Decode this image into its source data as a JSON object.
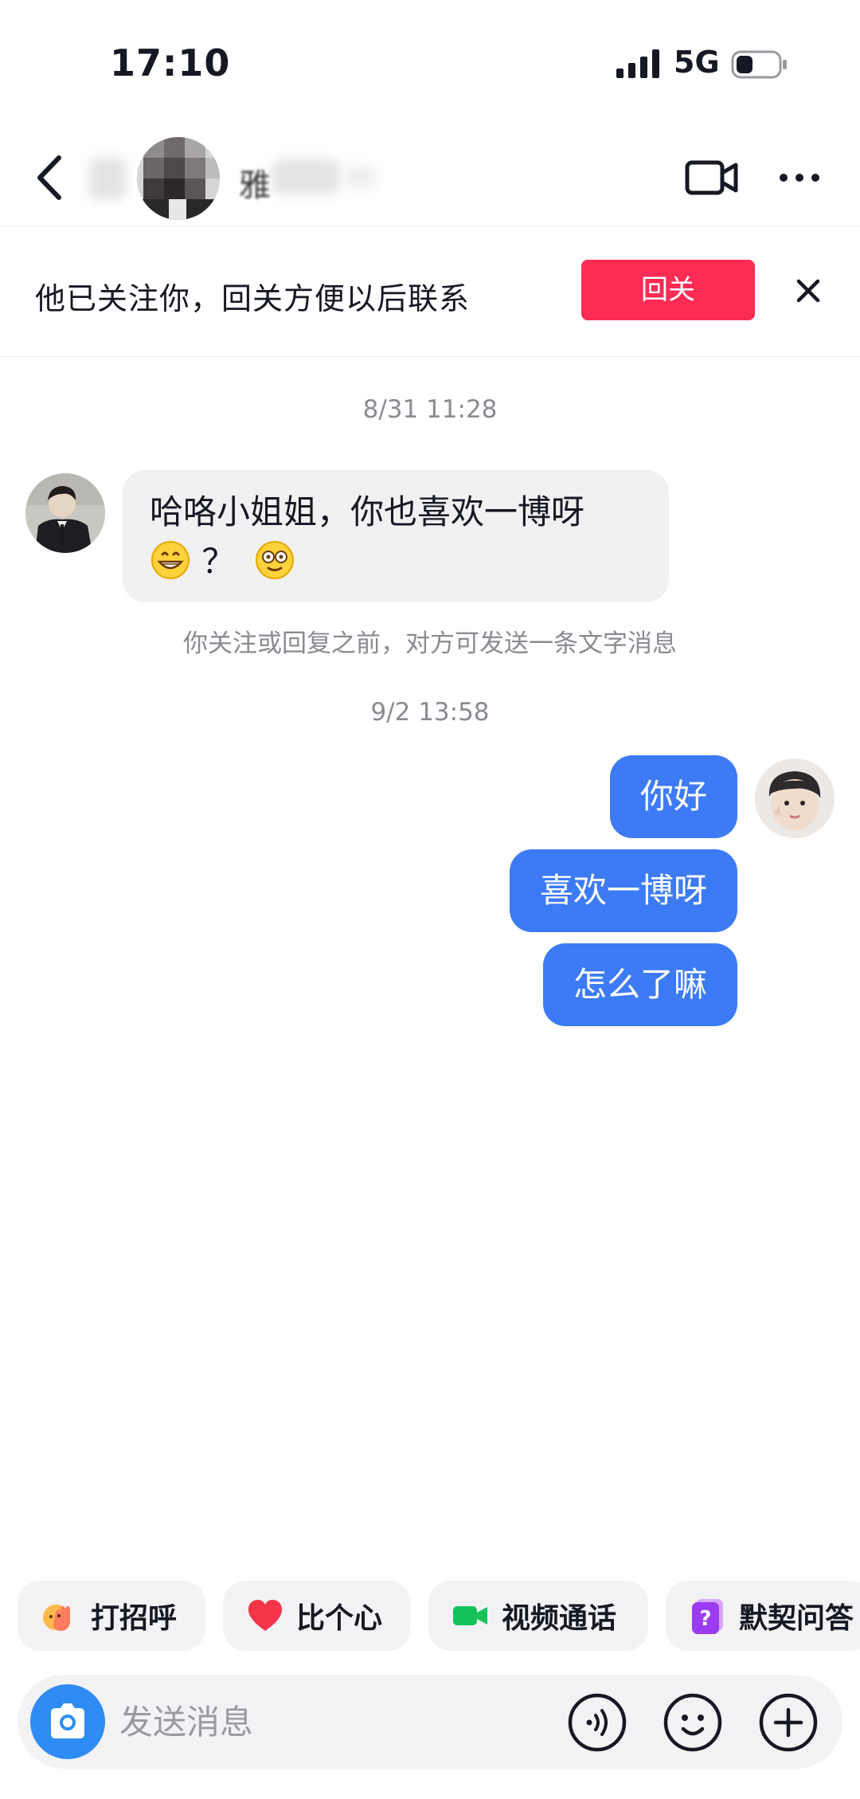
{
  "status": {
    "time": "17:10",
    "network": "5G"
  },
  "header": {
    "name_visible": "雅"
  },
  "follow_banner": {
    "text": "他已关注你，回关方便以后联系",
    "button": "回关"
  },
  "chat": {
    "timestamp_1": "8/31 11:28",
    "incoming": {
      "text": "哈咯小姐姐，你也喜欢一博呀",
      "question_mark": "？"
    },
    "system_note": "你关注或回复之前，对方可发送一条文字消息",
    "timestamp_2": "9/2 13:58",
    "outgoing": [
      "你好",
      "喜欢一博呀",
      "怎么了嘛"
    ]
  },
  "quick_actions": [
    {
      "label": "打招呼",
      "icon": "wave-hand-icon"
    },
    {
      "label": "比个心",
      "icon": "heart-icon"
    },
    {
      "label": "视频通话",
      "icon": "video-call-icon"
    },
    {
      "label": "默契问答",
      "icon": "question-card-icon"
    }
  ],
  "composer": {
    "placeholder": "发送消息"
  },
  "colors": {
    "accent_red": "#fe2c55",
    "bubble_blue": "#3d7bf6",
    "camera_blue": "#2f8cf5"
  }
}
